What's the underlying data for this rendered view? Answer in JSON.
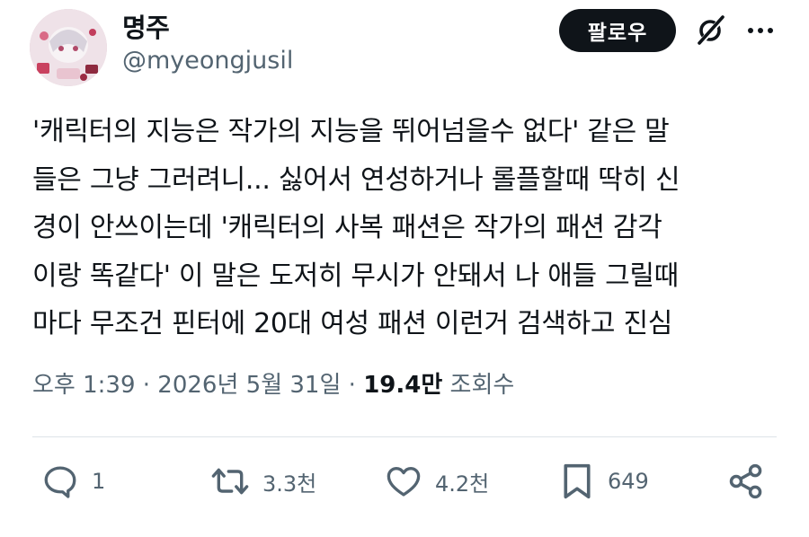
{
  "author": {
    "display_name": "명주",
    "handle": "@myeongjusil"
  },
  "header": {
    "follow_label": "팔로우",
    "icons": [
      "grok-icon",
      "more-icon"
    ]
  },
  "tweet": {
    "lines": [
      "'캐릭터의 지능은 작가의 지능을 뛰어넘을수 없다' 같은 말",
      "들은 그냥 그러려니... 싫어서 연성하거나 롤플할때 딱히 신",
      "경이 안쓰이는데 '캐릭터의 사복 패션은 작가의 패션 감각",
      "이랑 똑같다' 이 말은 도저히 무시가 안돼서 나 애들 그릴때",
      "마다 무조건 핀터에 20대 여성 패션 이런거 검색하고 진심"
    ]
  },
  "meta": {
    "time": "오후 1:39",
    "separator": " · ",
    "date": "2026년 5월 31일",
    "views_count": "19.4만",
    "views_label": "조회수"
  },
  "actions": {
    "reply_count": "1",
    "retweet_count": "3.3천",
    "like_count": "4.2천",
    "bookmark_count": "649"
  },
  "colors": {
    "text": "#0f1419",
    "secondary": "#536471",
    "button_bg": "#0f1419",
    "divider": "#dde3e8"
  }
}
